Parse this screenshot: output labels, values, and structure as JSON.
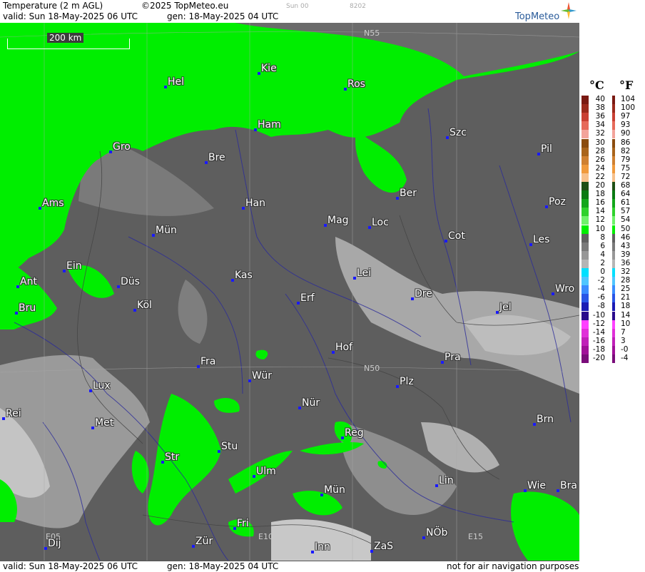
{
  "header": {
    "title": "Temperature (2 m AGL)",
    "copyright": "©2025 TopMeteo.eu",
    "run_code": "Sun 00",
    "code2": "8202",
    "valid": "valid:  Sun  18-May-2025  06 UTC",
    "gen": "gen: 18-May-2025 04 UTC",
    "brand": "TopMeteo"
  },
  "footer": {
    "valid": "valid:  Sun  18-May-2025  06 UTC",
    "gen": "gen: 18-May-2025 04 UTC",
    "notice": "not for air navigation purposes"
  },
  "scale_bar": "200 km",
  "grid_labels": [
    "N55",
    "N50",
    "E05",
    "E10",
    "E15"
  ],
  "cities": [
    "Hel",
    "Kie",
    "Ros",
    "Ham",
    "Szc",
    "Gro",
    "Bre",
    "Pil",
    "Ber",
    "Ams",
    "Han",
    "Poz",
    "Mag",
    "Loc",
    "Mün",
    "Cot",
    "Les",
    "Ein",
    "Ant",
    "Düs",
    "Kas",
    "Lei",
    "Wro",
    "Bru",
    "Köl",
    "Erf",
    "Dre",
    "Jel",
    "Hof",
    "Fra",
    "Pra",
    "Lux",
    "Wür",
    "Plz",
    "Rei",
    "Nür",
    "Met",
    "Brn",
    "Reg",
    "Stu",
    "Str",
    "Ulm",
    "Lin",
    "Mün",
    "Wie",
    "Bra",
    "Fri",
    "NÖb",
    "Dij",
    "Zür",
    "Inn",
    "ZaS"
  ],
  "legend": {
    "unit_c": "°C",
    "unit_f": "°F",
    "celsius": [
      "40",
      "38",
      "36",
      "34",
      "32",
      "30",
      "28",
      "26",
      "24",
      "22",
      "20",
      "18",
      "16",
      "14",
      "12",
      "10",
      "8",
      "6",
      "4",
      "2",
      "0",
      "-2",
      "-4",
      "-6",
      "-8",
      "-10",
      "-12",
      "-14",
      "-16",
      "-18",
      "-20"
    ],
    "fahrenheit": [
      "104",
      "100",
      "97",
      "93",
      "90",
      "86",
      "82",
      "79",
      "75",
      "72",
      "68",
      "64",
      "61",
      "57",
      "54",
      "50",
      "46",
      "43",
      "39",
      "36",
      "32",
      "28",
      "25",
      "21",
      "18",
      "14",
      "10",
      "7",
      "3",
      "-0",
      "-4"
    ],
    "colors": [
      "#7a1a12",
      "#9b2a1c",
      "#c94033",
      "#e66a5a",
      "#f3a39a",
      "#8b4c0f",
      "#a9641b",
      "#cf8030",
      "#f09a3c",
      "#f7c08a",
      "#1f4f14",
      "#0a7a12",
      "#13a61a",
      "#2fd12c",
      "#6ef26a",
      "#00ee00",
      "#606060",
      "#7a7a7a",
      "#979797",
      "#b5b5b5",
      "#00e0ff",
      "#4fc6ff",
      "#3b8cff",
      "#2a55e6",
      "#1b1bb4",
      "#2a0a8c",
      "#ff40ff",
      "#e030d8",
      "#c020b8",
      "#a01098",
      "#7a0c7a"
    ]
  }
}
